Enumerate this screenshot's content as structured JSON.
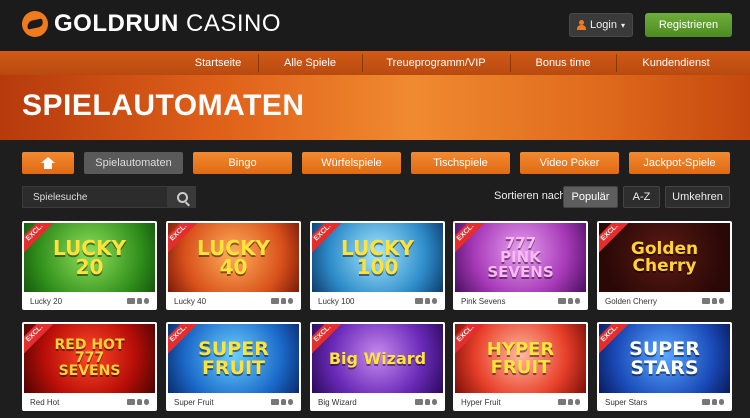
{
  "header": {
    "brand_bold": "GOLDRUN",
    "brand_light": "CASINO",
    "login_label": "Login",
    "register_label": "Registrieren"
  },
  "nav": {
    "items": [
      "Startseite",
      "Alle Spiele",
      "Treueprogramm/VIP",
      "Bonus time",
      "Kundendienst"
    ]
  },
  "banner": {
    "title": "SPIELAUTOMATEN"
  },
  "categories": {
    "active": "Spielautomaten",
    "items": [
      "Spielautomaten",
      "Bingo",
      "Würfelspiele",
      "Tischspiele",
      "Video Poker",
      "Jackpot-Spiele"
    ]
  },
  "search": {
    "placeholder": "Spielesuche"
  },
  "sort": {
    "label": "Sortieren nach",
    "active": "Populär",
    "options": [
      "Populär",
      "A-Z",
      "Umkehren"
    ]
  },
  "badge": "EXCL.",
  "games": [
    {
      "name": "Lucky 20",
      "art": "LUCKY\n20",
      "color": "#ffe23a",
      "excl": true
    },
    {
      "name": "Lucky 40",
      "art": "LUCKY\n40",
      "color": "#ffe23a",
      "excl": true
    },
    {
      "name": "Lucky 100",
      "art": "LUCKY\n100",
      "color": "#ffe23a",
      "excl": true
    },
    {
      "name": "Pink Sevens",
      "art": "777\nPINK\nSEVENS",
      "color": "#ffb8f4",
      "excl": true
    },
    {
      "name": "Golden Cherry",
      "art": "Golden\nCherry",
      "color": "#ffd23a",
      "excl": true
    },
    {
      "name": "Red Hot",
      "art": "RED HOT\n777\nSEVENS",
      "color": "#ffd23a",
      "excl": true
    },
    {
      "name": "Super Fruit",
      "art": "SUPER\nFRUIT",
      "color": "#ffe23a",
      "excl": true
    },
    {
      "name": "Big Wizard",
      "art": "Big Wizard",
      "color": "#ffe23a",
      "excl": true
    },
    {
      "name": "Hyper Fruit",
      "art": "HYPER\nFRUIT",
      "color": "#ffe23a",
      "excl": true
    },
    {
      "name": "Super Stars",
      "art": "SUPER\nSTARS",
      "color": "#ffffff",
      "excl": true
    }
  ],
  "colors": {
    "accent": "#f07a1e",
    "register": "#5c9a2c",
    "badge": "#e52d2d"
  }
}
